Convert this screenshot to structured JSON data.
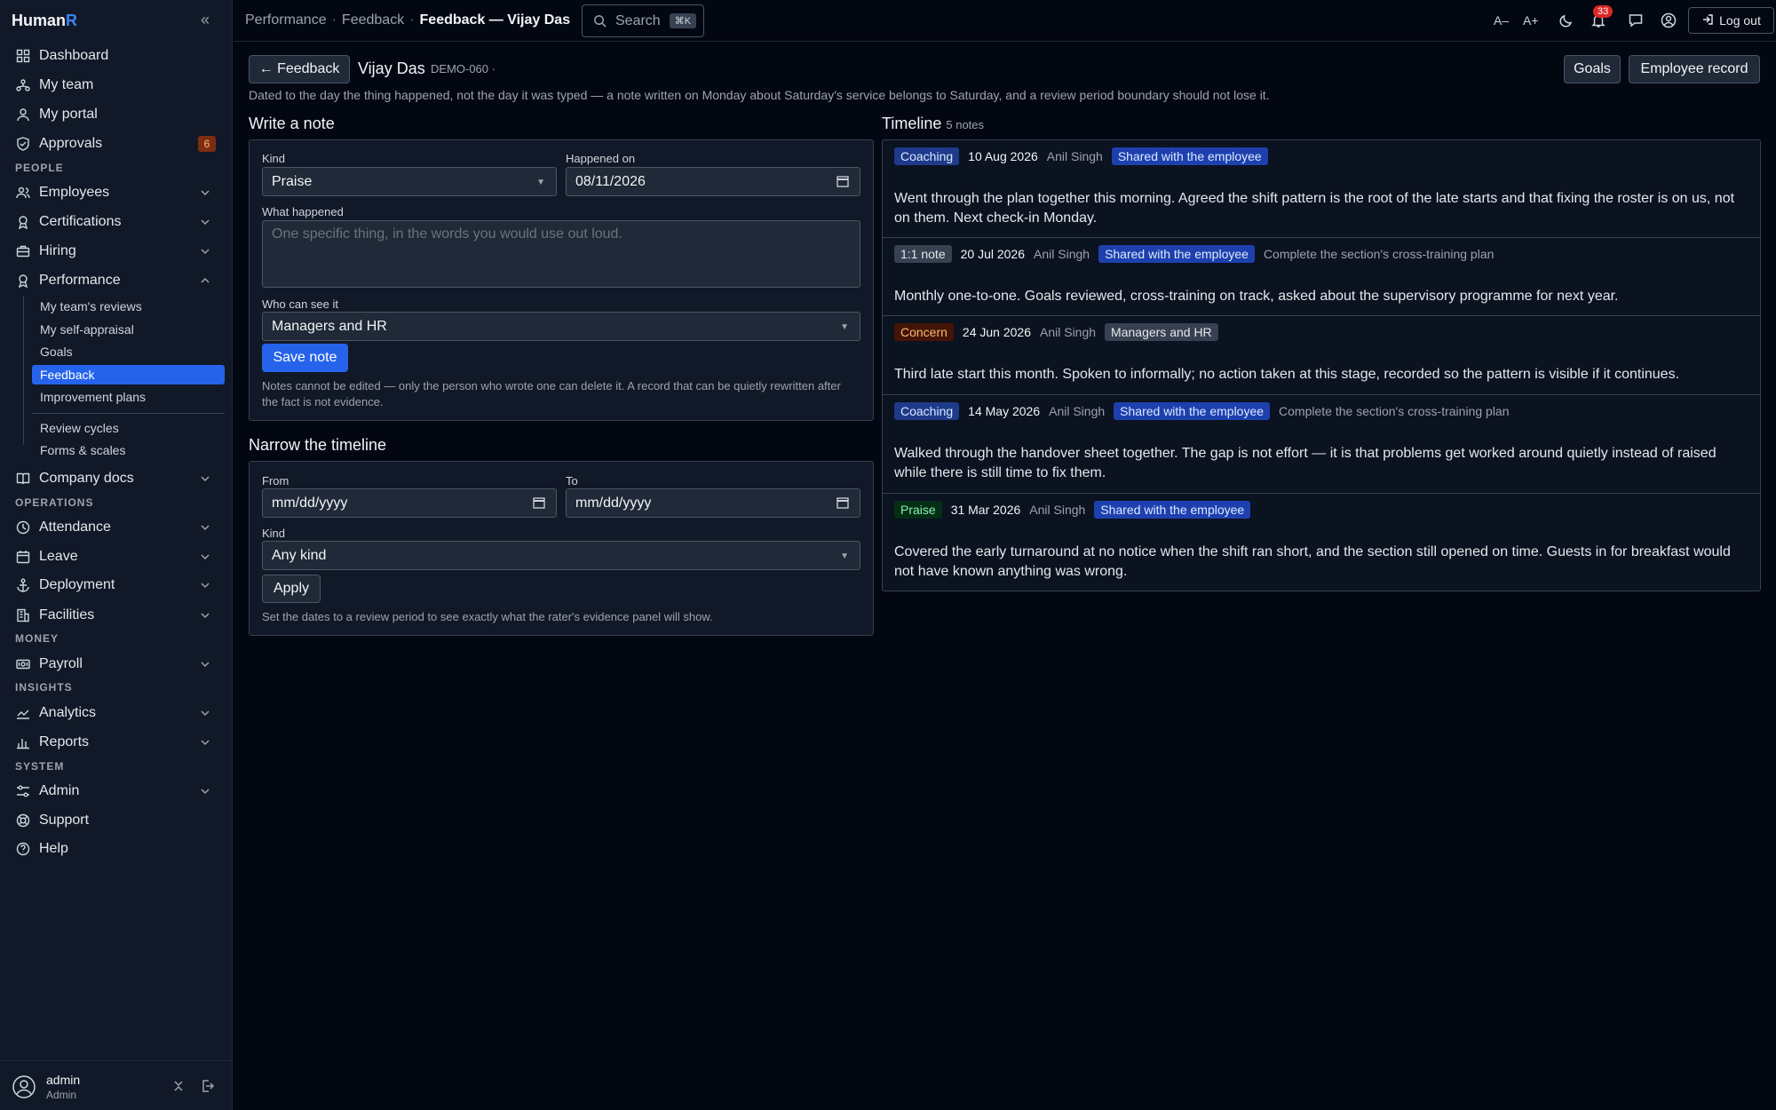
{
  "app": {
    "brand_main": "Human",
    "brand_accent": "R"
  },
  "sidebar": {
    "items": [
      {
        "label": "Dashboard",
        "icon": "grid-icon"
      },
      {
        "label": "My team",
        "icon": "team-icon"
      },
      {
        "label": "My portal",
        "icon": "user-icon"
      },
      {
        "label": "Approvals",
        "icon": "shield-check-icon",
        "badge": "6"
      }
    ],
    "sections": {
      "people": "PEOPLE",
      "operations": "OPERATIONS",
      "money": "MONEY",
      "insights": "INSIGHTS",
      "system": "SYSTEM"
    },
    "people_items": [
      {
        "label": "Employees",
        "icon": "users-icon"
      },
      {
        "label": "Certifications",
        "icon": "award-icon"
      },
      {
        "label": "Hiring",
        "icon": "briefcase-icon"
      },
      {
        "label": "Performance",
        "icon": "medal-icon"
      }
    ],
    "performance_sub": [
      "My team's reviews",
      "My self-appraisal",
      "Goals",
      "Feedback",
      "Improvement plans"
    ],
    "performance_sub2": [
      "Review cycles",
      "Forms & scales"
    ],
    "company_docs": "Company docs",
    "operations_items": [
      "Attendance",
      "Leave",
      "Deployment",
      "Facilities"
    ],
    "money_items": [
      "Payroll"
    ],
    "insights_items": [
      "Analytics",
      "Reports"
    ],
    "system_items": [
      "Admin",
      "Support",
      "Help"
    ],
    "user": {
      "name": "admin",
      "role": "Admin"
    }
  },
  "topbar": {
    "breadcrumb": [
      "Performance",
      "Feedback",
      "Feedback — Vijay Das"
    ],
    "search_label": "Search",
    "search_kbd": "⌘K",
    "font_smaller": "A–",
    "font_larger": "A+",
    "notifications": "33",
    "logout": "Log out"
  },
  "page": {
    "back_label": "← Feedback",
    "employee_name": "Vijay Das",
    "employee_id": "DEMO-060 ·",
    "goals_btn": "Goals",
    "record_btn": "Employee record",
    "description": "Dated to the day the thing happened, not the day it was typed — a note written on Monday about Saturday's service belongs to Saturday, and a review period boundary should not lose it."
  },
  "note_form": {
    "title": "Write a note",
    "kind_label": "Kind",
    "kind_value": "Praise",
    "happened_label": "Happened on",
    "happened_value": "08/11/2026",
    "what_label": "What happened",
    "what_placeholder": "One specific thing, in the words you would use out loud.",
    "visibility_label": "Who can see it",
    "visibility_value": "Managers and HR",
    "save_btn": "Save note",
    "help": "Notes cannot be edited — only the person who wrote one can delete it. A record that can be quietly rewritten after the fact is not evidence."
  },
  "filter_form": {
    "title": "Narrow the timeline",
    "from_label": "From",
    "from_value": "mm/dd/yyyy",
    "to_label": "To",
    "to_value": "mm/dd/yyyy",
    "kind_label": "Kind",
    "kind_value": "Any kind",
    "apply_btn": "Apply",
    "help": "Set the dates to a review period to see exactly what the rater's evidence panel will show."
  },
  "timeline": {
    "title": "Timeline",
    "count": "5 notes",
    "notes": [
      {
        "kind": "Coaching",
        "date": "10 Aug 2026",
        "author": "Anil Singh",
        "visibility": "Shared with the employee",
        "goal": "",
        "text": "Went through the plan together this morning. Agreed the shift pattern is the root of the late starts and that fixing the roster is on us, not on them. Next check-in Monday."
      },
      {
        "kind": "1:1 note",
        "date": "20 Jul 2026",
        "author": "Anil Singh",
        "visibility": "Shared with the employee",
        "goal": "Complete the section's cross-training plan",
        "text": "Monthly one-to-one. Goals reviewed, cross-training on track, asked about the supervisory programme for next year."
      },
      {
        "kind": "Concern",
        "date": "24 Jun 2026",
        "author": "Anil Singh",
        "visibility": "Managers and HR",
        "goal": "",
        "text": "Third late start this month. Spoken to informally; no action taken at this stage, recorded so the pattern is visible if it continues."
      },
      {
        "kind": "Coaching",
        "date": "14 May 2026",
        "author": "Anil Singh",
        "visibility": "Shared with the employee",
        "goal": "Complete the section's cross-training plan",
        "text": "Walked through the handover sheet together. The gap is not effort — it is that problems get worked around quietly instead of raised while there is still time to fix them."
      },
      {
        "kind": "Praise",
        "date": "31 Mar 2026",
        "author": "Anil Singh",
        "visibility": "Shared with the employee",
        "goal": "",
        "text": "Covered the early turnaround at no notice when the shift ran short, and the section still opened on time. Guests in for breakfast would not have known anything was wrong."
      }
    ]
  }
}
